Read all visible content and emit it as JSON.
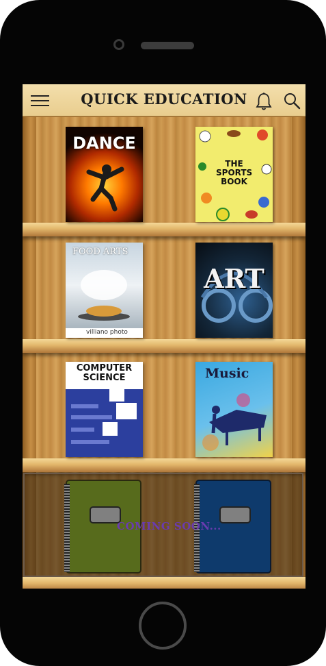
{
  "app": {
    "title": "QUICK EDUCATION",
    "menu_icon": "hamburger-menu-icon",
    "notification_icon": "bell-icon",
    "search_icon": "search-icon"
  },
  "books": [
    {
      "title": "DANCE",
      "colors": [
        "#000000",
        "#ff7a00"
      ]
    },
    {
      "title": "THE SPORTS BOOK",
      "colors": [
        "#e8e04a",
        "#f4ee7a"
      ]
    },
    {
      "title": "FOOD ARTS",
      "publisher": "villiano photo",
      "colors": [
        "#ffffff",
        "#8fa9c0"
      ]
    },
    {
      "title": "ART",
      "colors": [
        "#0d1520",
        "#2e5f8f"
      ]
    },
    {
      "title": "COMPUTER SCIENCE",
      "colors": [
        "#ffffff",
        "#3346a8"
      ]
    },
    {
      "title": "Music",
      "colors": [
        "#3aa8e0",
        "#f0d24a"
      ]
    }
  ],
  "coming_soon": {
    "text": "COMING SOON...",
    "notebooks": [
      {
        "color": "#576b1c"
      },
      {
        "color": "#0e3a6c"
      }
    ]
  }
}
